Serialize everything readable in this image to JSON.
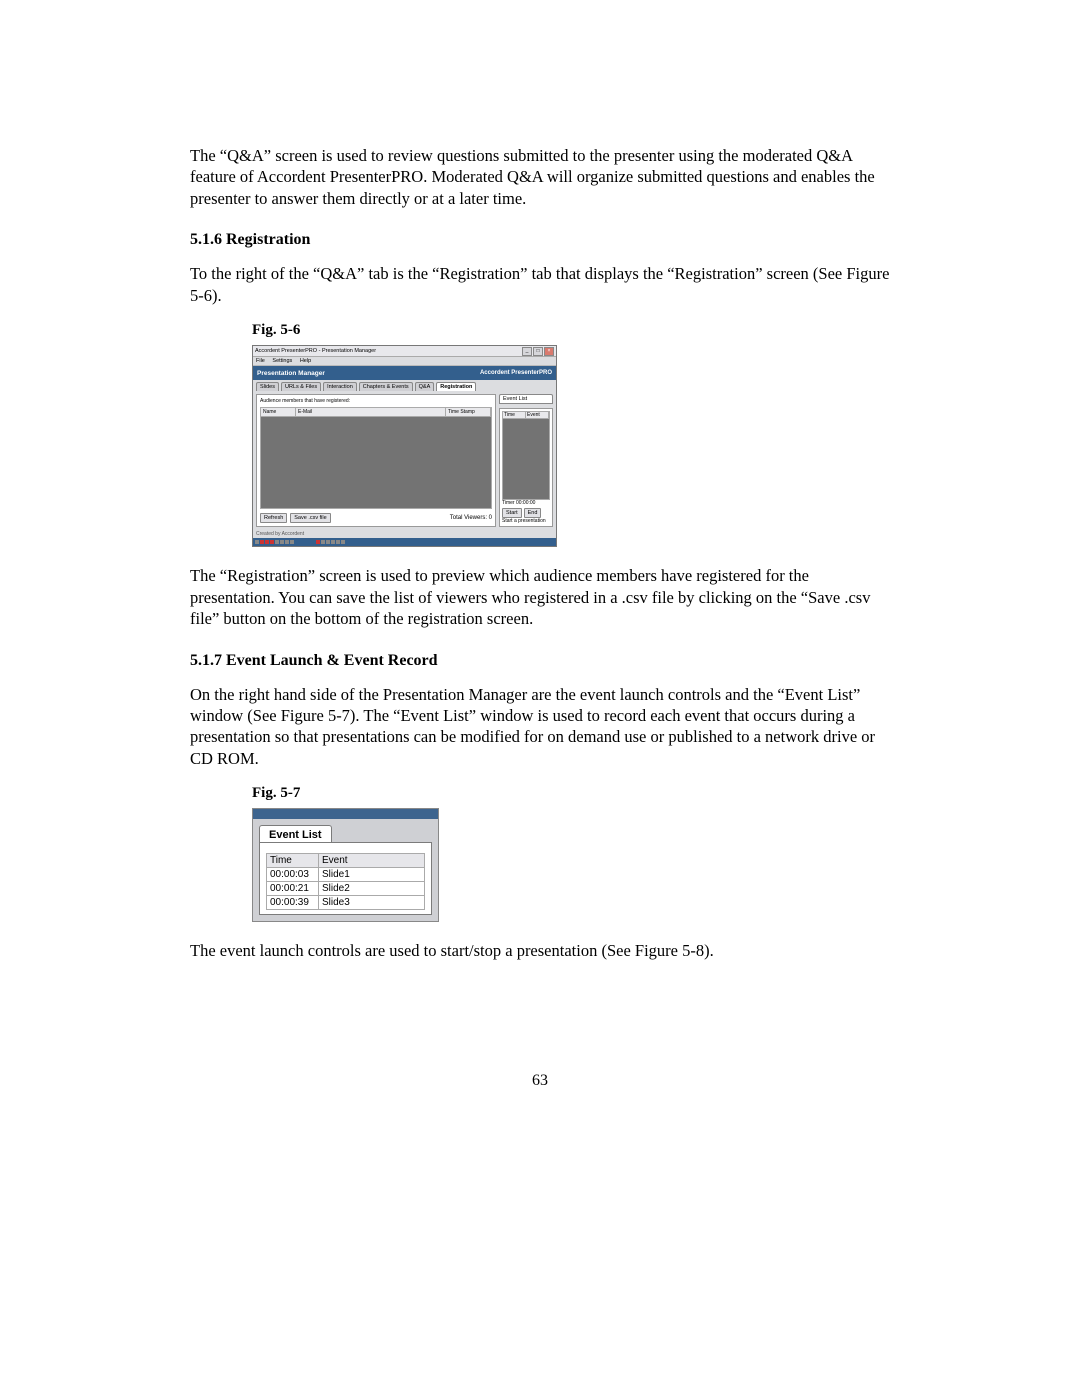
{
  "paragraphs": {
    "p1": "The “Q&A” screen is used to review questions submitted to the presenter using the moderated Q&A feature of Accordent PresenterPRO.  Moderated Q&A will organize submitted questions and enables the presenter to answer them directly or at a later time.",
    "h1": "5.1.6  Registration",
    "p2": "To the right of the “Q&A” tab is the “Registration” tab that displays the “Registration” screen (See Figure 5-6).",
    "fig56_label": "Fig. 5-6",
    "p3": "The “Registration” screen is used to preview which audience members have registered for the presentation. You can save the list of viewers who registered in a .csv file by clicking on the “Save .csv file” button on the bottom of the registration screen.",
    "h2": "5.1.7  Event Launch & Event Record",
    "p4": "On the right hand side of the Presentation Manager are the event launch controls and the “Event List” window (See Figure 5-7). The “Event List” window is used to record each event that occurs during a presentation so that presentations can be modified for on demand use or published to a network drive or CD ROM.",
    "fig57_label": "Fig. 5-7",
    "p5": "The event launch controls are used to start/stop a presentation (See Figure 5-8).",
    "page_num": "63"
  },
  "fig56": {
    "window_title": "Accordent PresenterPRO - Presentation Manager",
    "menu": {
      "file": "File",
      "settings": "Settings",
      "help": "Help"
    },
    "banner_title": "Presentation Manager",
    "banner_brand": "Accordent PresenterPRO",
    "tabs": {
      "slides": "Slides",
      "urls": "URLs & Files",
      "interaction": "Interaction",
      "chapters": "Chapters & Events",
      "qa": "Q&A",
      "registration": "Registration",
      "eventlist": "Event List"
    },
    "note": "Audience members that have registered:",
    "columns": {
      "name": "Name",
      "email": "E-Mail",
      "timestamp": "Time Stamp"
    },
    "buttons": {
      "refresh": "Refresh",
      "save_csv": "Save .csv file"
    },
    "total_label": "Total Viewers: 0",
    "event_cols": {
      "time": "Time",
      "event": "Event"
    },
    "timer": "Timer  00:00:00",
    "launch_buttons": {
      "start": "Start",
      "end": "End"
    },
    "start_help": "Start a presentation"
  },
  "fig57": {
    "tab": "Event List",
    "headers": {
      "time": "Time",
      "event": "Event"
    },
    "rows": [
      {
        "time": "00:00:03",
        "event": "Slide1"
      },
      {
        "time": "00:00:21",
        "event": "Slide2"
      },
      {
        "time": "00:00:39",
        "event": "Slide3"
      }
    ]
  }
}
